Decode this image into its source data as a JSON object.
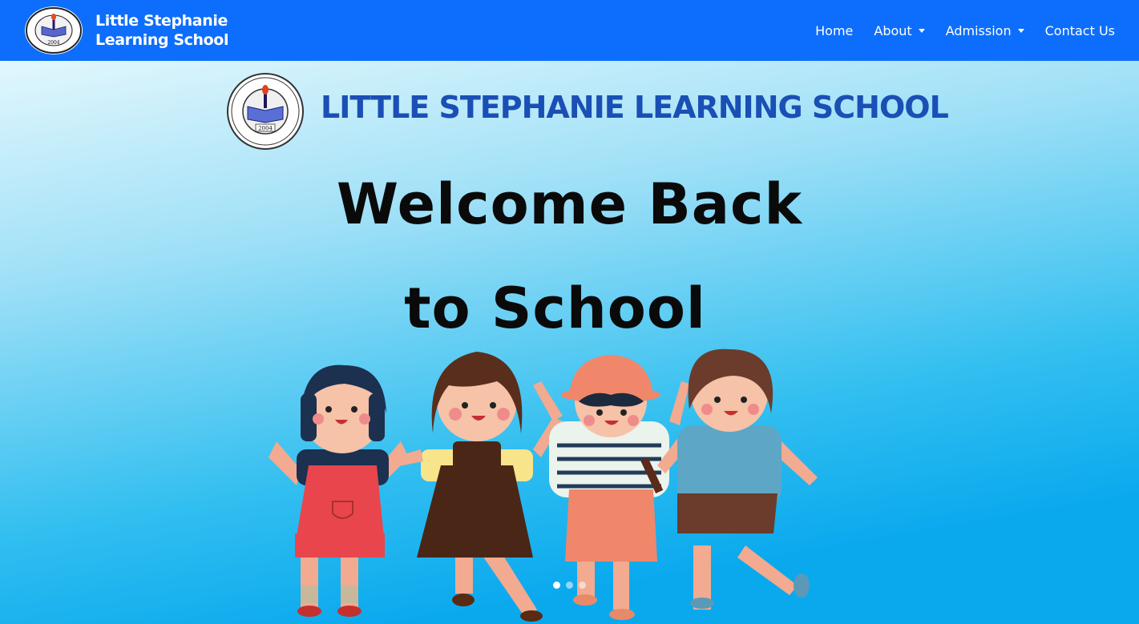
{
  "navbar": {
    "brand": {
      "line1": "Little Stephanie",
      "line2": "Learning School"
    },
    "links": {
      "home": "Home",
      "about": "About",
      "admission": "Admission",
      "contact": "Contact Us"
    },
    "colors": {
      "background": "#0d6efd",
      "text": "#ffffff"
    }
  },
  "hero": {
    "school_name": "LITTLE STEPHANIE LEARNING SCHOOL",
    "welcome_line1": "Welcome Back",
    "welcome_line2": "to School",
    "seal_year": "2004",
    "carousel": {
      "slide_count": 3,
      "active_index": 0
    },
    "colors": {
      "sky_top": "#d9f4fc",
      "sky_bottom": "#0fb0f2",
      "title": "#1a4fb5"
    }
  },
  "icons": [
    "school-seal-icon",
    "dropdown-caret-icon",
    "carousel-indicator-icon"
  ]
}
